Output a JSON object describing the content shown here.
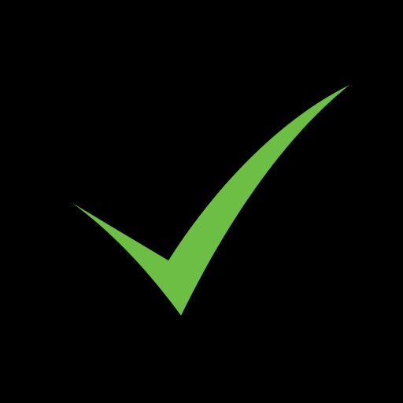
{
  "icon": {
    "name": "checkmark-icon",
    "color": "#6DBE45"
  },
  "background": {
    "color": "#000000"
  }
}
